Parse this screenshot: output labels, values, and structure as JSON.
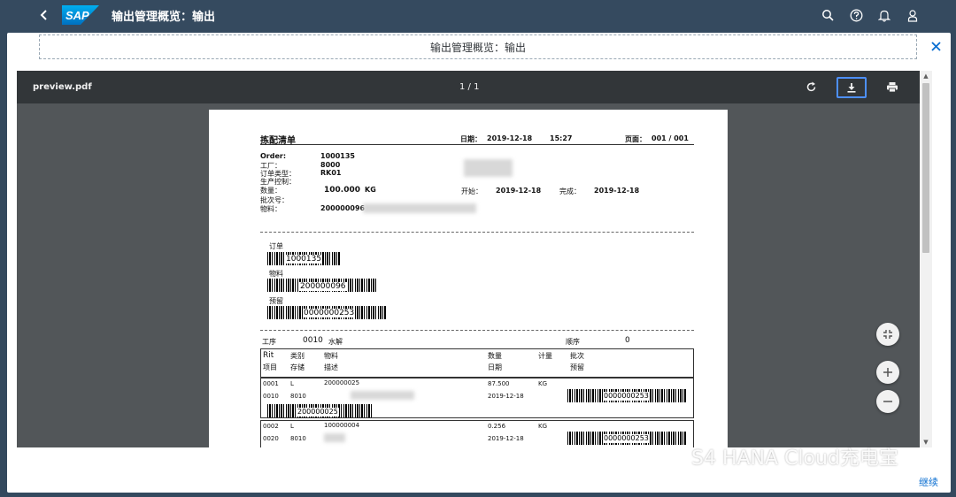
{
  "shell": {
    "logo_text": "SAP",
    "title": "输出管理概览：输出",
    "icons": [
      "back-icon",
      "search-icon",
      "help-icon",
      "bell-icon",
      "user-icon"
    ]
  },
  "dialog": {
    "title": "输出管理概览：输出",
    "continue_label": "继续"
  },
  "viewer": {
    "filename": "preview.pdf",
    "page_indicator": "1 / 1"
  },
  "document": {
    "title": "拣配清单",
    "date_label": "日期：",
    "date": "2019-12-18",
    "time": "15:27",
    "page_label": "页面：",
    "page_value": "001 / 001",
    "fields": {
      "order_label": "Order:",
      "order_value": "1000135",
      "plant_label": "工厂：",
      "plant_value": "8000",
      "order_type_label": "订单类型：",
      "order_type_value": "RK01",
      "prod_sched_label": "生产控制：",
      "qty_label": "数量：",
      "qty_value": "100.000",
      "qty_unit": "KG",
      "start_label": "开始：",
      "start_value": "2019-12-18",
      "finish_label": "完成：",
      "finish_value": "2019-12-18",
      "batch_label": "批次号：",
      "material_label": "物料：",
      "material_value": "200000096"
    },
    "barcodes": {
      "order_label": "订单",
      "order_code": "1000135",
      "material_label": "物料",
      "material_code": "200000096",
      "reservation_label": "预留",
      "reservation_code": "0000000253"
    },
    "operation": {
      "op_label": "工序",
      "op_value": "0010",
      "op_desc": "水解",
      "seq_label": "顺序",
      "seq_value": "0"
    },
    "table_headers": {
      "h1a": "Rit",
      "h1b": "项目",
      "h2a": "类别",
      "h2b": "存储",
      "h3a": "物料",
      "h3b": "描述",
      "h4a": "数量",
      "h4b": "日期",
      "h5a": "计量",
      "h6a": "批次",
      "h6b": "预留"
    },
    "rows": [
      {
        "item": "0001",
        "cat": "L",
        "material": "200000025",
        "qty": "87.500",
        "unit": "KG",
        "op": "0010",
        "storage": "8010",
        "date": "2019-12-18",
        "res_code": "0000000253",
        "mat_code": "200000025"
      },
      {
        "item": "0002",
        "cat": "L",
        "material": "100000004",
        "qty": "0.256",
        "unit": "KG",
        "op": "0020",
        "storage": "8010",
        "date": "2019-12-18",
        "res_code": "0000000253"
      }
    ]
  },
  "watermark": "S4 HANA Cloud充电宝"
}
